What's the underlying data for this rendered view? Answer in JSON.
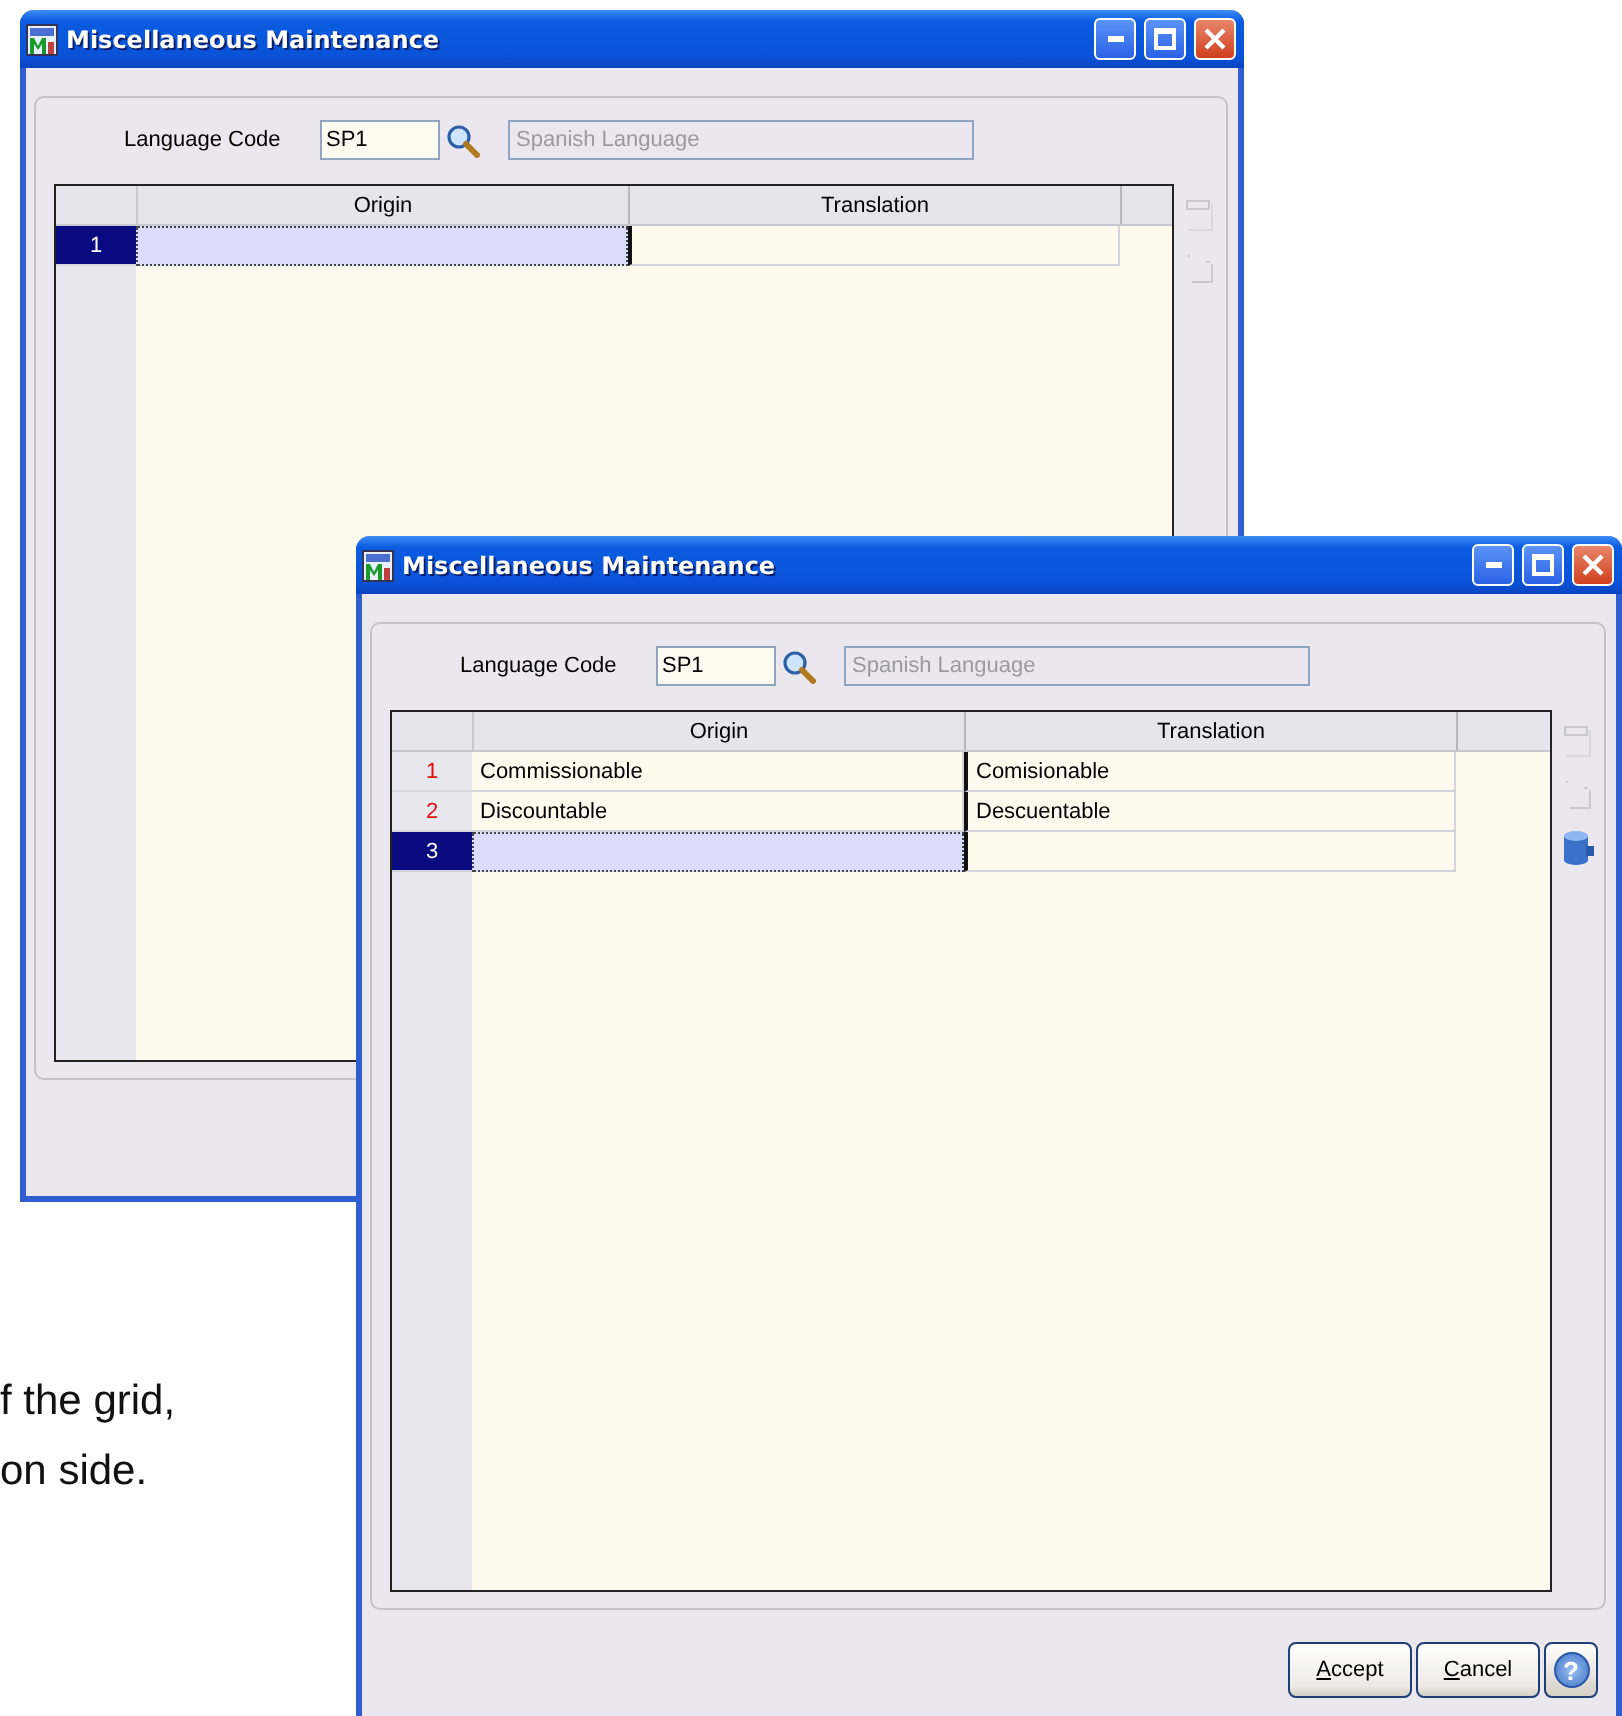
{
  "document_text": [
    "f the grid,",
    "on side."
  ],
  "windows": [
    {
      "title": "Miscellaneous Maintenance",
      "language_code_label": "Language Code",
      "language_code": "SP1",
      "description_field": {
        "value": "Spanish Language",
        "disabled": true
      },
      "grid": {
        "columns": [
          "Origin",
          "Translation"
        ],
        "rows": [
          {
            "number": "1",
            "selected": true
          }
        ]
      },
      "record_icon": false
    },
    {
      "title": "Miscellaneous Maintenance",
      "language_code_label": "Language Code",
      "language_code": "SP1",
      "description_field": {
        "value": "Spanish Language",
        "disabled": true
      },
      "grid": {
        "columns": [
          "Origin",
          "Translation"
        ],
        "rows": [
          {
            "number": "1",
            "origin": "Commissionable",
            "translation": "Comisionable",
            "selected": false
          },
          {
            "number": "2",
            "origin": "Discountable",
            "translation": "Descuentable",
            "selected": false
          },
          {
            "number": "3",
            "selected": true
          }
        ]
      },
      "record_icon": true,
      "buttons": [
        {
          "kind": "text",
          "label": "Accept",
          "underline_first": true
        },
        {
          "kind": "text",
          "label": "Cancel",
          "underline_first": true
        },
        {
          "kind": "help",
          "label": "?"
        }
      ]
    }
  ]
}
